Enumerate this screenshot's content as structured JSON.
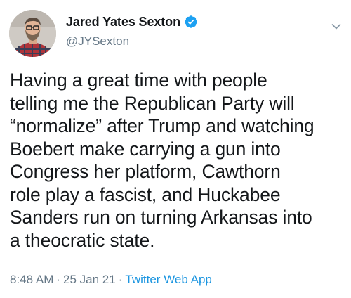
{
  "author": {
    "display_name": "Jared Yates Sexton",
    "handle": "@JYSexton",
    "verified": true
  },
  "tweet": {
    "lines": [
      "Having a great time with people",
      "telling me the Republican Party will",
      "“normalize” after Trump and watching",
      "Boebert make carrying a gun into",
      "Congress her platform, Cawthorn",
      "role play a fascist, and Huckabee",
      "Sanders run on turning Arkansas into",
      "a theocratic state."
    ]
  },
  "meta": {
    "time": "8:48 AM",
    "separator": "·",
    "date": "25 Jan 21",
    "source": "Twitter Web App"
  },
  "icons": {
    "verified": "verified-badge-icon",
    "menu": "chevron-down-icon"
  },
  "colors": {
    "text": "#14171a",
    "secondary": "#657786",
    "accent": "#1b95e0",
    "verified": "#1da1f2"
  }
}
